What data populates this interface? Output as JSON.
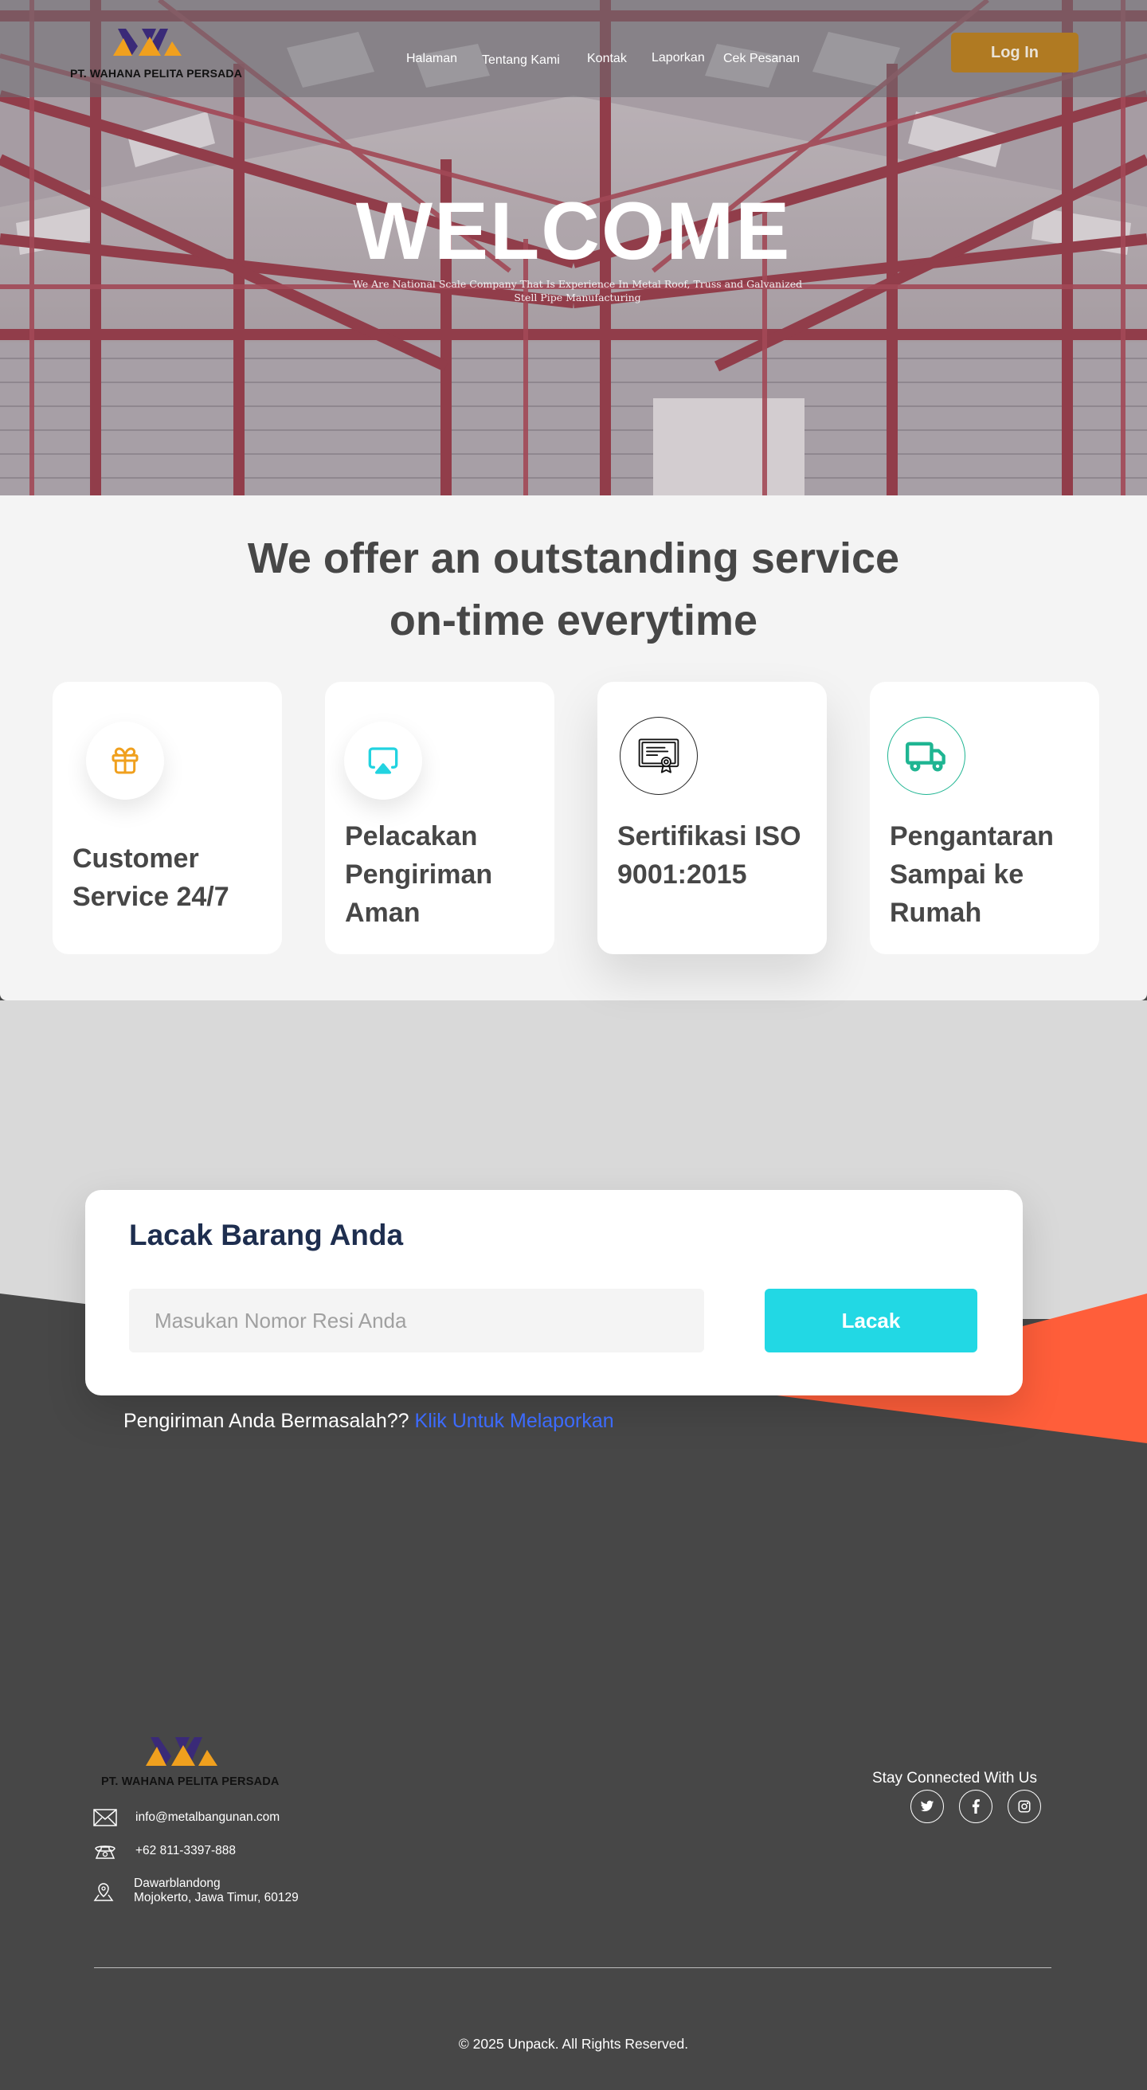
{
  "header": {
    "company_name": "PT. WAHANA PELITA PERSADA",
    "nav": [
      "Halaman",
      "Tentang Kami",
      "Kontak",
      "Laporkan",
      "Cek Pesanan"
    ],
    "login_label": "Log In"
  },
  "hero": {
    "title": "WELCOME",
    "subtitle": "We Are National Scale Company That Is Experience In Metal Roof, Truss and Galvanized Stell Pipe Manufacturing"
  },
  "services": {
    "title_line1": "We offer an outstanding service",
    "title_line2": "on-time everytime",
    "cards": [
      {
        "title": "Customer Service 24/7",
        "icon": "gift-icon",
        "color": "#f0a01e"
      },
      {
        "title": "Pelacakan Pengiriman Aman",
        "icon": "airplay-icon",
        "color": "#22d3e0"
      },
      {
        "title": "Sertifikasi ISO 9001:2015",
        "icon": "certificate-icon",
        "color": "#111111"
      },
      {
        "title": "Pengantaran Sampai ke Rumah",
        "icon": "truck-icon",
        "color": "#1fb592"
      }
    ]
  },
  "track": {
    "title": "Lacak Barang Anda",
    "placeholder": "Masukan Nomor Resi Anda",
    "button_label": "Lacak"
  },
  "report": {
    "text": "Pengiriman Anda Bermasalah??",
    "link": "Klik Untuk Melaporkan"
  },
  "footer": {
    "company_name": "PT. WAHANA PELITA PERSADA",
    "email": "info@metalbangunan.com",
    "phone": "+62 811-3397-888",
    "address_line1": "Dawarblandong",
    "address_line2": "Mojokerto, Jawa Timur, 60129",
    "stay_connected": "Stay Connected With Us",
    "social": [
      "twitter-icon",
      "facebook-icon",
      "instagram-icon"
    ],
    "copyright": "© 2025 Unpack. All Rights Reserved."
  },
  "colors": {
    "accent_gold": "#b07a22",
    "cyan": "#22d8e4",
    "dark_bg": "#474747",
    "orange_shape": "#ff5e3a",
    "navy_title": "#1e2e4f",
    "link_blue": "#3c6bff"
  }
}
